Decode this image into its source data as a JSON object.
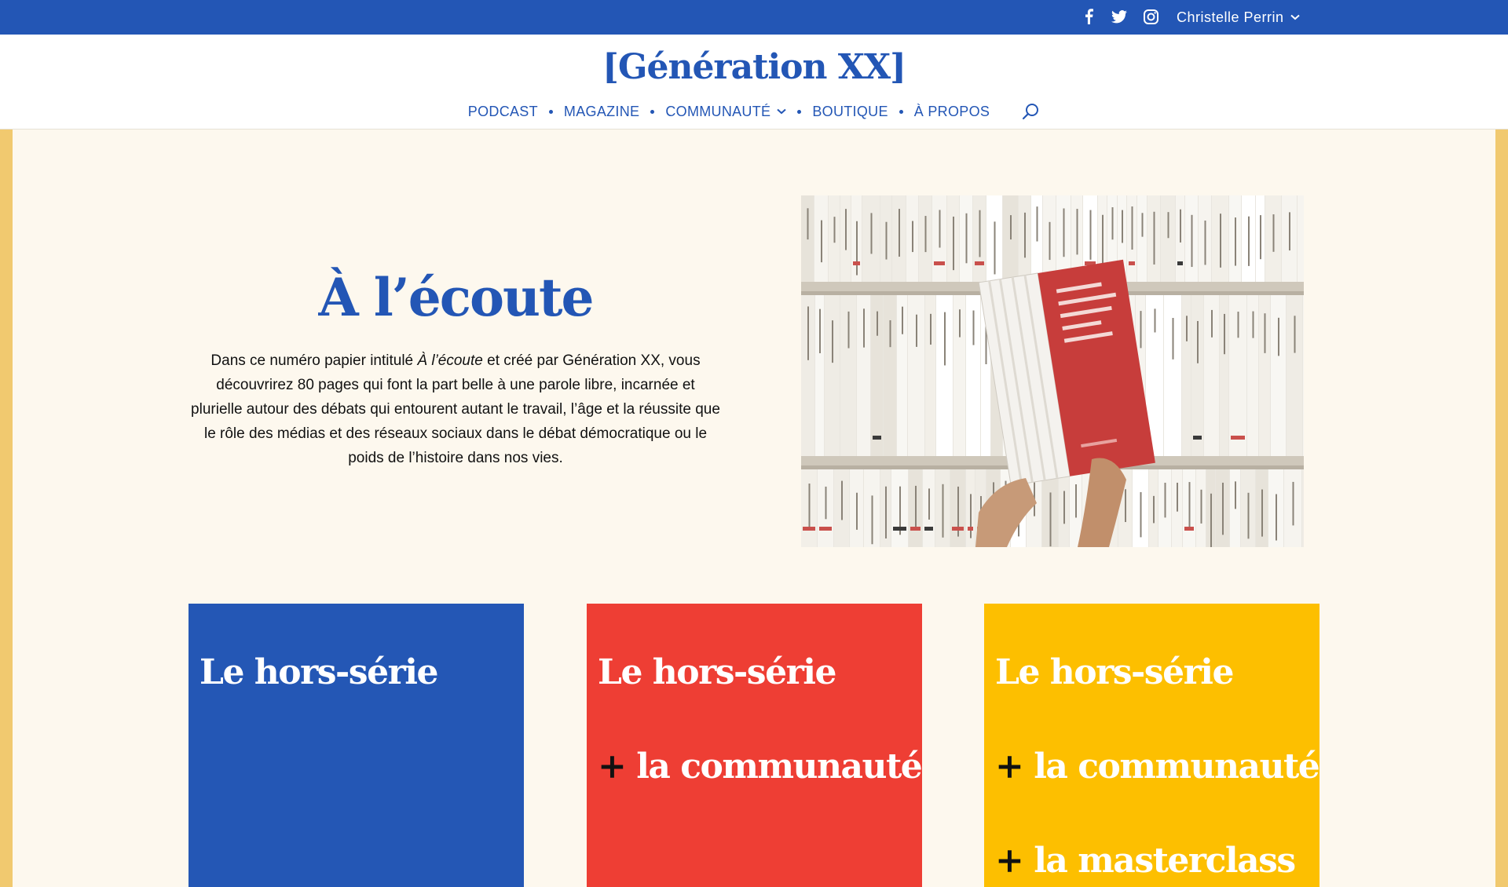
{
  "topbar": {
    "background": "#2356b5",
    "social_icons": [
      "facebook-icon",
      "twitter-icon",
      "instagram-icon"
    ],
    "user_name": "Christelle Perrin"
  },
  "header": {
    "logo": "[Génération XX]",
    "nav": [
      {
        "label": "PODCAST"
      },
      {
        "label": "MAGAZINE"
      },
      {
        "label": "COMMUNAUTÉ",
        "has_dropdown": true
      },
      {
        "label": "BOUTIQUE"
      },
      {
        "label": "À PROPOS"
      }
    ],
    "search_icon": "search-icon"
  },
  "hero": {
    "title": "À l’écoute",
    "text_intro": "Dans ce numéro papier intitulé ",
    "text_em": "À l’écoute",
    "text_rest": " et créé par Génération XX, vous découvrirez 80 pages qui font la part belle à une parole libre, incarnée et plurielle autour des débats qui entourent autant le travail, l’âge et la réussite que le rôle des médias et des réseaux sociaux dans le débat démocratique ou le poids de l’histoire dans nos vies."
  },
  "cards": [
    {
      "color": "#2457b5",
      "lines": [
        {
          "plus": "",
          "text": "Le hors-série"
        }
      ]
    },
    {
      "color": "#ee3e34",
      "lines": [
        {
          "plus": "",
          "text": "Le hors-série"
        },
        {
          "plus": "+",
          "text": "la communauté"
        }
      ]
    },
    {
      "color": "#fdbf00",
      "lines": [
        {
          "plus": "",
          "text": "Le hors-série"
        },
        {
          "plus": "+",
          "text": "la communauté"
        },
        {
          "plus": "+",
          "text": "la masterclass"
        }
      ]
    }
  ],
  "colors": {
    "brand_blue": "#2356b5",
    "page_background": "#fdf8ee",
    "side_accent": "#f1c96f",
    "red": "#ee3e34",
    "yellow": "#fdbf00"
  }
}
